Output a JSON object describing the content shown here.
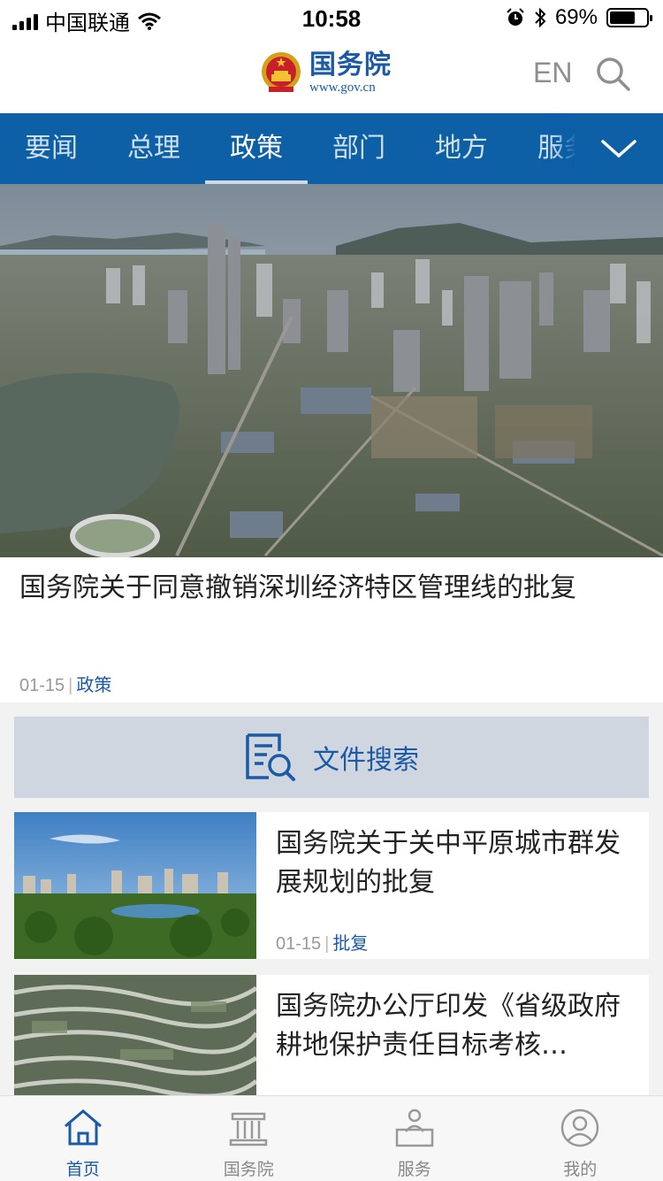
{
  "status_bar": {
    "carrier": "中国联通",
    "time": "10:58",
    "battery": "69%",
    "battery_level": 0.69
  },
  "header": {
    "logo_name": "国务院",
    "logo_url": "www.gov.cn",
    "lang_switch": "EN"
  },
  "nav": {
    "tabs": [
      "要闻",
      "总理",
      "政策",
      "部门",
      "地方",
      "服务"
    ],
    "active_index": 2
  },
  "hero": {
    "title": "国务院关于同意撤销深圳经济特区管理线的批复",
    "date": "01-15",
    "category": "政策"
  },
  "file_search": {
    "label": "文件搜索"
  },
  "news": [
    {
      "title": "国务院关于关中平原城市群发展规划的批复",
      "date": "01-15",
      "category": "批复"
    },
    {
      "title": "国务院办公厅印发《省级政府耕地保护责任目标考核…"
    }
  ],
  "tab_bar": [
    {
      "label": "首页",
      "active": true
    },
    {
      "label": "国务院",
      "active": false
    },
    {
      "label": "服务",
      "active": false
    },
    {
      "label": "我的",
      "active": false
    }
  ],
  "colors": {
    "brand_blue": "#1a5aa6",
    "nav_blue": "#0d5fa6",
    "search_bg": "#cfd6df"
  }
}
